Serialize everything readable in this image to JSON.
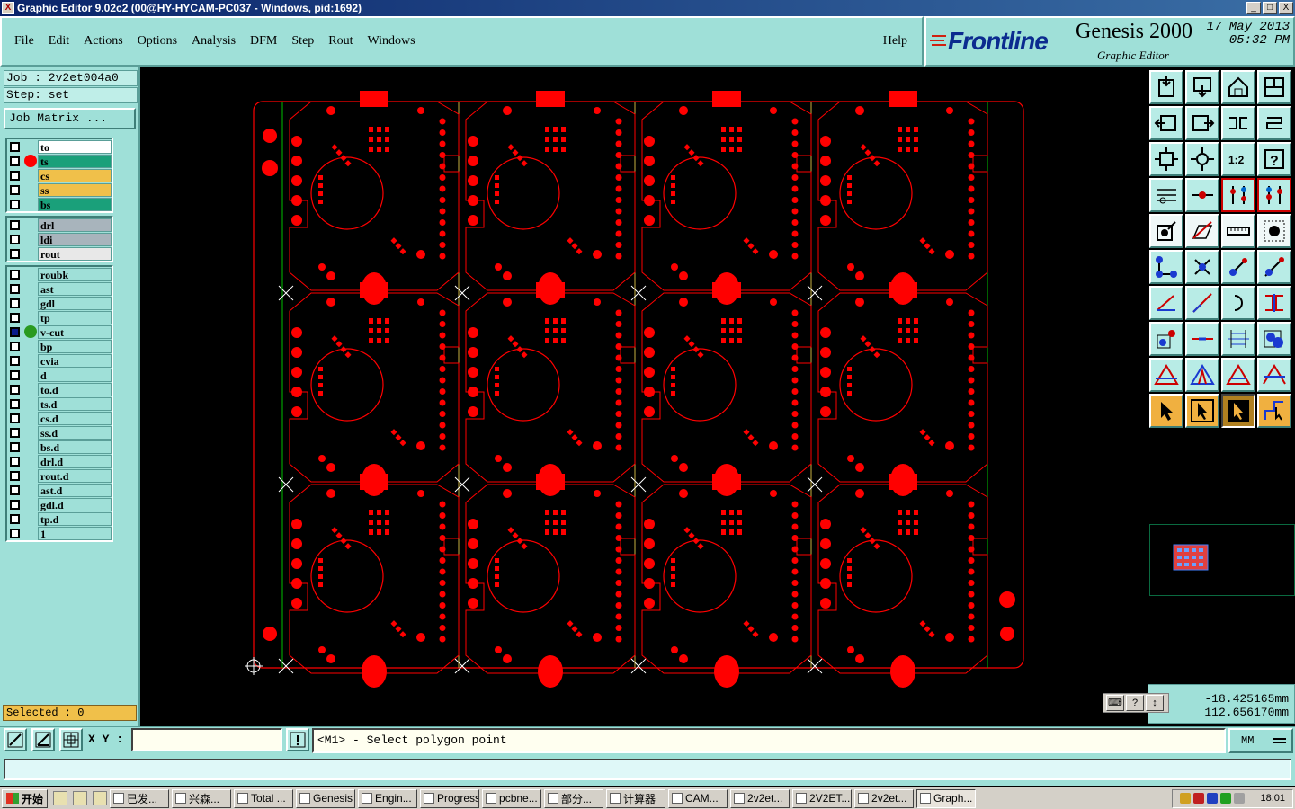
{
  "window": {
    "title": "Graphic Editor 9.02c2 (00@HY-HYCAM-PC037 - Windows, pid:1692)",
    "buttons": [
      "_",
      "□",
      "X"
    ]
  },
  "menu": {
    "items": [
      "File",
      "Edit",
      "Actions",
      "Options",
      "Analysis",
      "DFM",
      "Step",
      "Rout",
      "Windows"
    ],
    "help": "Help"
  },
  "brand": {
    "logo": "Frontline",
    "product": "Genesis 2000",
    "subtitle": "Graphic Editor",
    "date": "17 May 2013",
    "time": "05:32 PM"
  },
  "job": {
    "job_label": "Job : 2v2et004a0",
    "step_label": "Step: set",
    "matrix_button": "Job Matrix ..."
  },
  "layer_groups": [
    [
      {
        "name": "to",
        "color": "#ffffff"
      },
      {
        "name": "ts",
        "color": "#1aa07a",
        "dot": "#ff0000"
      },
      {
        "name": "cs",
        "color": "#f0c04a"
      },
      {
        "name": "ss",
        "color": "#f0c04a"
      },
      {
        "name": "bs",
        "color": "#1aa07a"
      }
    ],
    [
      {
        "name": "drl",
        "color": "#a8b4bc"
      },
      {
        "name": "ldi",
        "color": "#a8b4bc"
      },
      {
        "name": "rout",
        "color": "#e8e8e8"
      }
    ],
    [
      {
        "name": "roubk"
      },
      {
        "name": "ast"
      },
      {
        "name": "gdl"
      },
      {
        "name": "tp"
      },
      {
        "name": "v-cut",
        "dot": "#2a9a20",
        "checked": true
      },
      {
        "name": "bp"
      },
      {
        "name": "cvia"
      },
      {
        "name": "d"
      },
      {
        "name": "to.d"
      },
      {
        "name": "ts.d"
      },
      {
        "name": "cs.d"
      },
      {
        "name": "ss.d"
      },
      {
        "name": "bs.d"
      },
      {
        "name": "drl.d"
      },
      {
        "name": "rout.d"
      },
      {
        "name": "ast.d"
      },
      {
        "name": "gdl.d"
      },
      {
        "name": "tp.d"
      },
      {
        "name": "1"
      }
    ]
  ],
  "selected_text": "Selected : 0",
  "coords": {
    "x": "-18.425165mm",
    "y": "112.656170mm"
  },
  "command": {
    "xy_label": "X Y :",
    "xy_value": "",
    "prompt": "<M1> - Select polygon point",
    "units": "MM"
  },
  "board": {
    "columns": 4,
    "rows": 3,
    "trace_color": "#ff0000",
    "vcut_color": "#00c000"
  },
  "taskbar": {
    "start": "开始",
    "tasks": [
      "已发...",
      "兴森...",
      "Total ...",
      "Genesis",
      "Engin...",
      "Progress",
      "pcbne...",
      "部分...",
      "计算器",
      "CAM...",
      "2v2et...",
      "2V2ET...",
      "2v2et...",
      "Graph..."
    ],
    "clock": "18:01"
  }
}
